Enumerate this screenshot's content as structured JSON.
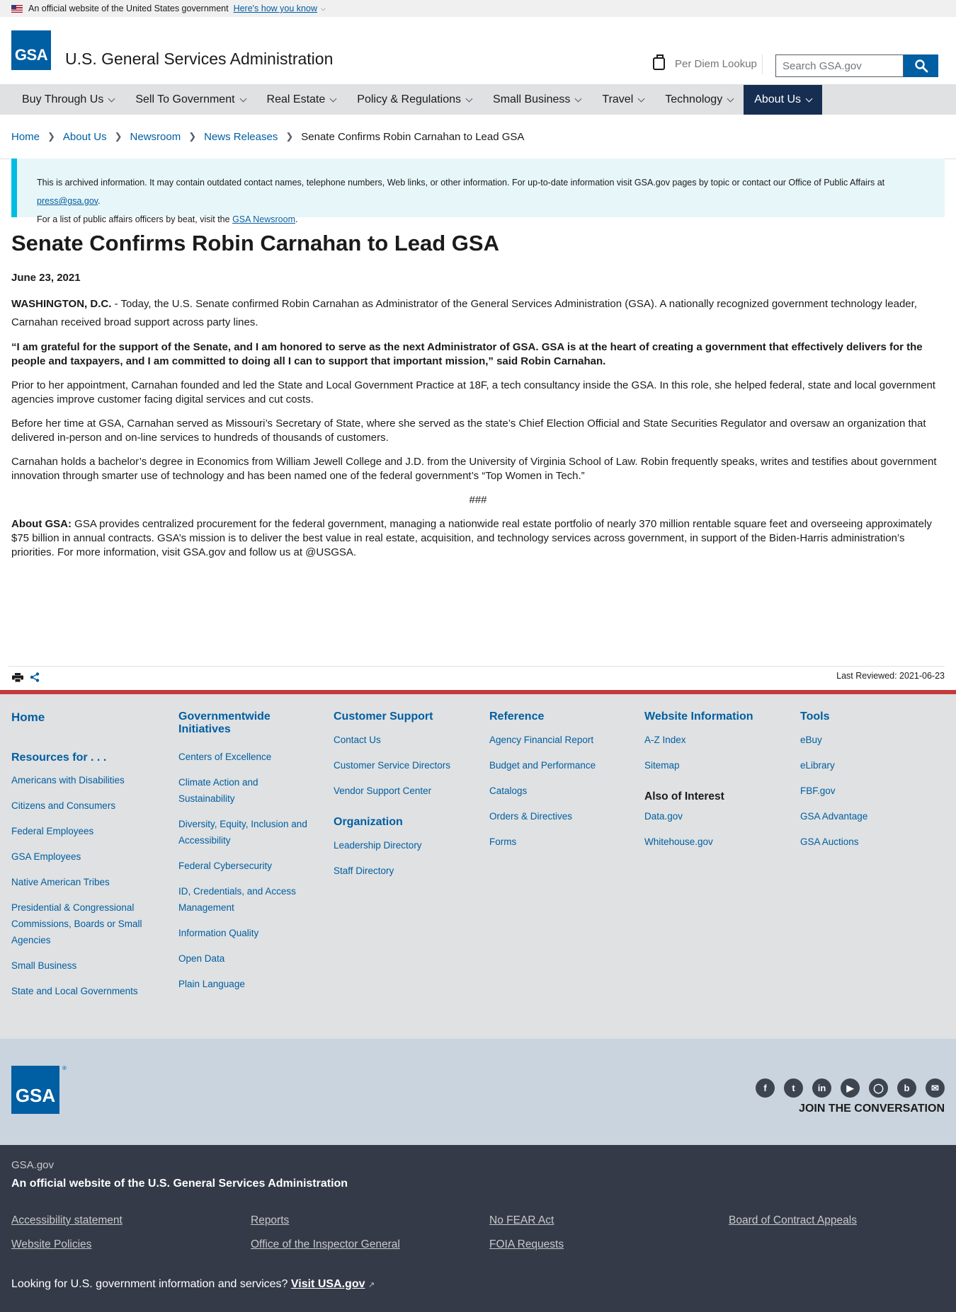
{
  "gov_banner": {
    "text": "An official website of the United States government",
    "link": "Here's how you know"
  },
  "header": {
    "logo": "GSA",
    "title": "U.S. General Services Administration",
    "per_diem": "Per Diem Lookup",
    "search_placeholder": "Search GSA.gov"
  },
  "nav": [
    {
      "label": "Buy Through Us"
    },
    {
      "label": "Sell To Government"
    },
    {
      "label": "Real Estate"
    },
    {
      "label": "Policy & Regulations"
    },
    {
      "label": "Small Business"
    },
    {
      "label": "Travel"
    },
    {
      "label": "Technology"
    },
    {
      "label": "About Us",
      "active": true
    }
  ],
  "breadcrumb": {
    "items": [
      "Home",
      "About Us",
      "Newsroom",
      "News Releases"
    ],
    "current": "Senate Confirms Robin Carnahan to Lead GSA"
  },
  "alert": {
    "line1": "This is archived information. It may contain outdated contact names, telephone numbers, Web links, or other information. For up-to-date information visit GSA.gov pages by topic or contact our Office of Public Affairs at",
    "email": "press@gsa.gov",
    "line2_pre": "For a list of public affairs officers by beat, visit the",
    "line2_link": "GSA Newsroom"
  },
  "article": {
    "title": "Senate Confirms Robin Carnahan to Lead GSA",
    "date": "June 23, 2021",
    "dateline": "WASHINGTON, D.C.",
    "p1": " - Today, the U.S. Senate confirmed Robin Carnahan as Administrator of the General Services Administration (GSA). A nationally recognized government technology leader, Carnahan received broad support across party lines.",
    "quote": "“I am grateful for the support of the Senate, and I am honored to serve as the next Administrator of GSA. GSA is at the heart of creating a government that effectively delivers for the people and taxpayers, and I am committed to doing all I can to support that important mission,” said Robin Carnahan.",
    "p2": "Prior to her appointment, Carnahan founded and led the State and Local Government Practice at 18F, a tech consultancy inside the GSA. In this role, she helped federal, state and local government agencies improve customer facing digital services and cut costs.",
    "p3": "Before her time at GSA, Carnahan served as Missouri’s Secretary of State, where she served as the state’s Chief Election Official and State Securities Regulator and oversaw an organization that delivered in-person and on-line services to hundreds of thousands of customers.",
    "p4": "Carnahan holds a bachelor’s degree in Economics from William Jewell College and J.D. from the University of Virginia School of Law. Robin frequently speaks, writes and testifies about government innovation through smarter use of technology and has been named one of the federal government’s “Top Women in Tech.”",
    "end_mark": "###",
    "about_label": "About GSA:",
    "about_text": " GSA provides centralized procurement for the federal government, managing a nationwide real estate portfolio of nearly 370 million rentable square feet and overseeing approximately $75 billion in annual contracts. GSA’s mission is to deliver the best value in real estate, acquisition, and technology services across government, in support of the Biden-Harris administration’s priorities. For more information, visit GSA.gov and follow us at @USGSA."
  },
  "share": {
    "last_reviewed": "Last Reviewed: 2021-06-23"
  },
  "footer": {
    "home": "Home",
    "resources_heading": "Resources for . . .",
    "resources": [
      "Americans with Disabilities",
      "Citizens and Consumers",
      "Federal Employees",
      "GSA Employees",
      "Native American Tribes",
      "Presidential & Congressional Commissions, Boards or Small Agencies",
      "Small Business",
      "State and Local Governments"
    ],
    "initiatives_heading": "Governmentwide Initiatives",
    "initiatives": [
      "Centers of Excellence",
      "Climate Action and Sustainability",
      "Diversity, Equity, Inclusion and Accessibility",
      "Federal Cybersecurity",
      "ID, Credentials, and Access Management",
      "Information Quality",
      "Open Data",
      "Plain Language"
    ],
    "support_heading": "Customer Support",
    "support": [
      "Contact Us",
      "Customer Service Directors",
      "Vendor Support Center"
    ],
    "organization_heading": "Organization",
    "organization": [
      "Leadership Directory",
      "Staff Directory"
    ],
    "reference_heading": "Reference",
    "reference": [
      "Agency Financial Report",
      "Budget and Performance",
      "Catalogs",
      "Orders & Directives",
      "Forms"
    ],
    "website_heading": "Website Information",
    "website": [
      "A-Z Index",
      "Sitemap"
    ],
    "interest_heading": "Also of Interest",
    "interest": [
      "Data.gov",
      "Whitehouse.gov"
    ],
    "tools_heading": "Tools",
    "tools": [
      "eBuy",
      "eLibrary",
      "FBF.gov",
      "GSA Advantage",
      "GSA Auctions"
    ]
  },
  "footer_secondary": {
    "logo": "GSA",
    "reg": "®",
    "social_icons": [
      "facebook-icon",
      "twitter-icon",
      "linkedin-icon",
      "youtube-icon",
      "instagram-icon",
      "blog-icon",
      "email-icon"
    ],
    "join": "JOIN THE CONVERSATION"
  },
  "identifier": {
    "domain": "GSA.gov",
    "title": "An official website of the U.S. General Services Administration",
    "links": [
      "Accessibility statement",
      "Reports",
      "No FEAR Act",
      "Board of Contract Appeals",
      "Website Policies",
      "Office of the Inspector General",
      "FOIA Requests"
    ],
    "usa_text": "Looking for U.S. government information and services?",
    "usa_link": "Visit USA.gov"
  },
  "colors": {
    "primary": "#005ea2",
    "nav_active": "#162e51",
    "alert_border": "#00bde3",
    "footer_bg": "#dfe1e2",
    "identifier_bg": "#343a48"
  }
}
